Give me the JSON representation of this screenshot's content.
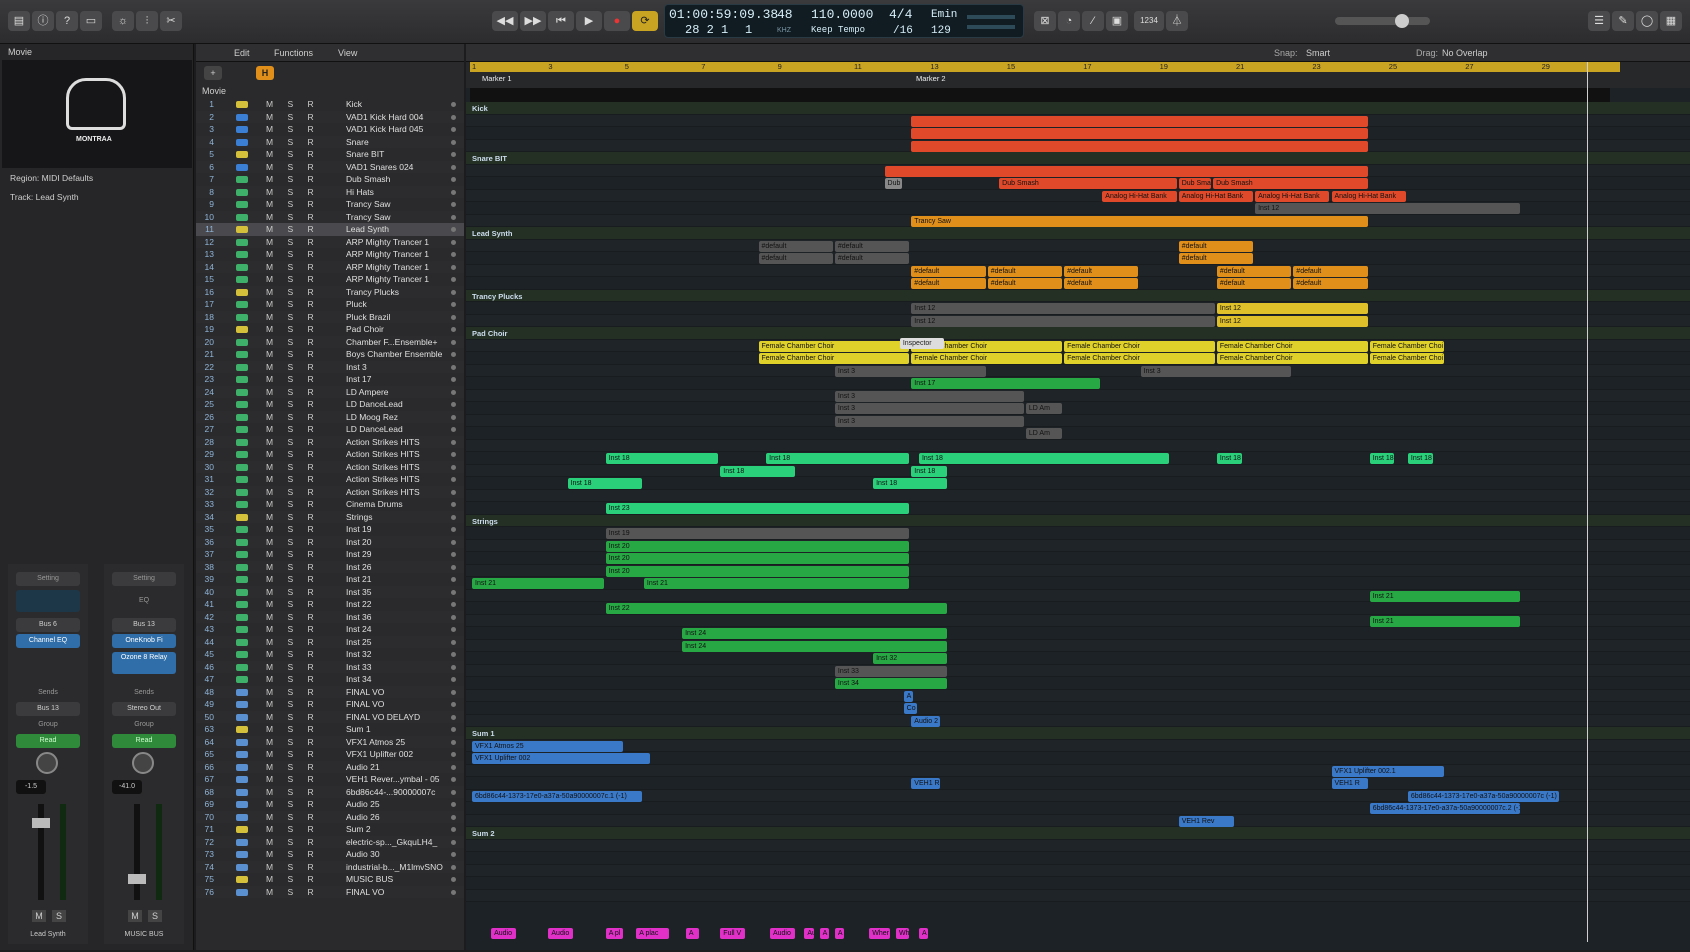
{
  "toolbar": {
    "lcd": {
      "position": "01:00:59:09.38",
      "bars": "28  2  1",
      "beat": "1",
      "tempo_top": "48",
      "tempo_bpm": "110.0000",
      "tempo_mode": "Keep Tempo",
      "sig_top": "4/4",
      "sig_bottom": "/16",
      "key": "Emin",
      "key_num": "129",
      "khz": "KHZ"
    },
    "count_in": "1234"
  },
  "inspector": {
    "movie_label": "Movie",
    "logo_text": "MONTRAA",
    "region_label": "Region: MIDI Defaults",
    "track_label": "Track:  Lead Synth",
    "strip1": {
      "setting": "Setting",
      "bus": "Bus 6",
      "eq": "Channel EQ",
      "sends": "Sends",
      "out": "Bus 13",
      "group": "Group",
      "read": "Read",
      "vol": "-1.5",
      "m": "M",
      "s": "S",
      "name": "Lead Synth"
    },
    "strip2": {
      "setting": "Setting",
      "eq_label": "EQ",
      "bus": "Bus 13",
      "plugin1": "OneKnob Fi",
      "plugin2": "Ozone 8 Relay",
      "sends": "Sends",
      "out": "Stereo Out",
      "group": "Group",
      "read": "Read",
      "vol": "-41.0",
      "m": "M",
      "s": "S",
      "name": "MUSIC BUS"
    }
  },
  "menubar": {
    "edit": "Edit",
    "functions": "Functions",
    "view": "View",
    "snap_label": "Snap:",
    "snap_value": "Smart",
    "drag_label": "Drag:",
    "drag_value": "No Overlap"
  },
  "ruler": {
    "bars": [
      "1",
      "3",
      "5",
      "7",
      "9",
      "11",
      "13",
      "15",
      "17",
      "19",
      "21",
      "23",
      "25",
      "27",
      "29"
    ],
    "marker1": "Marker 1",
    "marker2": "Marker 2",
    "movie_row": "Movie"
  },
  "tracks": [
    {
      "n": "1",
      "name": "Kick",
      "type": "folder"
    },
    {
      "n": "2",
      "name": "VAD1 Kick Hard 004",
      "type": "drum"
    },
    {
      "n": "3",
      "name": "VAD1 Kick Hard 045",
      "type": "drum"
    },
    {
      "n": "4",
      "name": "Snare",
      "type": "drum"
    },
    {
      "n": "5",
      "name": "Snare BIT",
      "type": "folder"
    },
    {
      "n": "6",
      "name": "VAD1 Snares 024",
      "type": "drum"
    },
    {
      "n": "7",
      "name": "Dub Smash",
      "type": "inst"
    },
    {
      "n": "8",
      "name": "Hi Hats",
      "type": "inst"
    },
    {
      "n": "9",
      "name": "Trancy Saw",
      "type": "inst"
    },
    {
      "n": "10",
      "name": "Trancy Saw",
      "type": "inst"
    },
    {
      "n": "11",
      "name": "Lead Synth",
      "type": "folder",
      "selected": true
    },
    {
      "n": "12",
      "name": "ARP Mighty Trancer 1",
      "type": "inst"
    },
    {
      "n": "13",
      "name": "ARP Mighty Trancer 1",
      "type": "inst"
    },
    {
      "n": "14",
      "name": "ARP Mighty Trancer 1",
      "type": "inst"
    },
    {
      "n": "15",
      "name": "ARP Mighty Trancer 1",
      "type": "inst"
    },
    {
      "n": "16",
      "name": "Trancy Plucks",
      "type": "folder"
    },
    {
      "n": "17",
      "name": "Pluck",
      "type": "inst"
    },
    {
      "n": "18",
      "name": "Pluck Brazil",
      "type": "inst"
    },
    {
      "n": "19",
      "name": "Pad Choir",
      "type": "folder"
    },
    {
      "n": "20",
      "name": "Chamber F...Ensemble+",
      "type": "inst"
    },
    {
      "n": "21",
      "name": "Boys Chamber Ensemble",
      "type": "inst"
    },
    {
      "n": "22",
      "name": "Inst 3",
      "type": "inst"
    },
    {
      "n": "23",
      "name": "Inst 17",
      "type": "inst"
    },
    {
      "n": "24",
      "name": "LD Ampere",
      "type": "inst"
    },
    {
      "n": "25",
      "name": "LD DanceLead",
      "type": "inst"
    },
    {
      "n": "26",
      "name": "LD Moog Rez",
      "type": "inst"
    },
    {
      "n": "27",
      "name": "LD DanceLead",
      "type": "inst"
    },
    {
      "n": "28",
      "name": "Action Strikes HITS",
      "type": "inst"
    },
    {
      "n": "29",
      "name": "Action Strikes HITS",
      "type": "inst"
    },
    {
      "n": "30",
      "name": "Action Strikes HITS",
      "type": "inst"
    },
    {
      "n": "31",
      "name": "Action Strikes HITS",
      "type": "inst"
    },
    {
      "n": "32",
      "name": "Action Strikes HITS",
      "type": "inst"
    },
    {
      "n": "33",
      "name": "Cinema Drums",
      "type": "inst"
    },
    {
      "n": "34",
      "name": "Strings",
      "type": "folder"
    },
    {
      "n": "35",
      "name": "Inst 19",
      "type": "inst"
    },
    {
      "n": "36",
      "name": "Inst 20",
      "type": "inst"
    },
    {
      "n": "37",
      "name": "Inst 29",
      "type": "inst"
    },
    {
      "n": "38",
      "name": "Inst 26",
      "type": "inst"
    },
    {
      "n": "39",
      "name": "Inst 21",
      "type": "inst"
    },
    {
      "n": "40",
      "name": "Inst 35",
      "type": "inst"
    },
    {
      "n": "41",
      "name": "Inst 22",
      "type": "inst"
    },
    {
      "n": "42",
      "name": "Inst 36",
      "type": "inst"
    },
    {
      "n": "43",
      "name": "Inst 24",
      "type": "inst"
    },
    {
      "n": "44",
      "name": "Inst 25",
      "type": "inst"
    },
    {
      "n": "45",
      "name": "Inst 32",
      "type": "inst"
    },
    {
      "n": "46",
      "name": "Inst 33",
      "type": "inst"
    },
    {
      "n": "47",
      "name": "Inst 34",
      "type": "inst"
    },
    {
      "n": "48",
      "name": "FINAL VO",
      "type": "audio"
    },
    {
      "n": "49",
      "name": "FINAL VO",
      "type": "audio"
    },
    {
      "n": "50",
      "name": "FINAL VO DELAYD",
      "type": "audio"
    },
    {
      "n": "63",
      "name": "Sum 1",
      "type": "folder"
    },
    {
      "n": "64",
      "name": "VFX1 Atmos 25",
      "type": "audio"
    },
    {
      "n": "65",
      "name": "VFX1 Uplifter 002",
      "type": "audio"
    },
    {
      "n": "66",
      "name": "Audio 21",
      "type": "audio"
    },
    {
      "n": "67",
      "name": "VEH1 Rever...ymbal - 05",
      "type": "audio"
    },
    {
      "n": "68",
      "name": "6bd86c44-...90000007c",
      "type": "audio"
    },
    {
      "n": "69",
      "name": "Audio 25",
      "type": "audio"
    },
    {
      "n": "70",
      "name": "Audio 26",
      "type": "audio"
    },
    {
      "n": "71",
      "name": "Sum 2",
      "type": "folder"
    },
    {
      "n": "72",
      "name": "electric-sp..._GkquLH4_",
      "type": "audio"
    },
    {
      "n": "73",
      "name": "Audio 30",
      "type": "audio"
    },
    {
      "n": "74",
      "name": "industrial-b..._M1lmvSNO",
      "type": "audio"
    },
    {
      "n": "75",
      "name": "MUSIC BUS",
      "type": "bus"
    },
    {
      "n": "76",
      "name": "FINAL VO",
      "type": "audio"
    }
  ],
  "folder_labels": {
    "kick": "Kick",
    "snare": "Snare BIT",
    "lead": "Lead Synth",
    "plucks": "Trancy Plucks",
    "pad": "Pad Choir",
    "strings": "Strings",
    "sum1": "Sum 1",
    "sum2": "Sum 2"
  },
  "regions": {
    "dub_smash": "Dub Smash",
    "dub_sm_short": "Dub Sm",
    "dub_smas": "Dub Smas",
    "hihat": "Analog Hi-Hat Bank",
    "inst12": "Inst 12",
    "trancy_saw": "Trancy Saw",
    "default": "#default",
    "choir": "Female Chamber Choir",
    "choir_short": "Female Chamber Choi",
    "inspector_tip": "Inspector",
    "inst3": "Inst 3",
    "inst17": "Inst 17",
    "ld_am": "LD Am",
    "inst18": "Inst 18",
    "inst23": "Inst 23",
    "inst19": "Inst 19",
    "inst20": "Inst 20",
    "inst21": "Inst 21",
    "inst22": "Inst 22",
    "inst24": "Inst 24",
    "inst32": "Inst 32",
    "inst33": "Inst 33",
    "inst34": "Inst 34",
    "a": "A",
    "co": "Co",
    "audio2": "Audio 2",
    "vfx_atmos": "VFX1 Atmos 25",
    "vfx_upl": "VFX1 Uplifter 002",
    "vfx_upl1": "VFX1 Uplifter 002.1",
    "veh1r": "VEH1 R",
    "veh1rev": "VEH1 Rev",
    "guid1": "6bd86c44-1373-17e0-a37a-50a90000007c.1 (-1)",
    "guid2": "6bd86c44-1373-17e0-a37a-50a90000007c (-1)",
    "guid3": "6bd86c44-1373-17e0-a37a-50a90000007c.2 (-1)",
    "audio": "Audio",
    "a_pl": "A pl",
    "a_plac": "A plac",
    "full_v": "Full V",
    "au": "Au",
    "wher": "Wher",
    "wh": "Wh"
  }
}
